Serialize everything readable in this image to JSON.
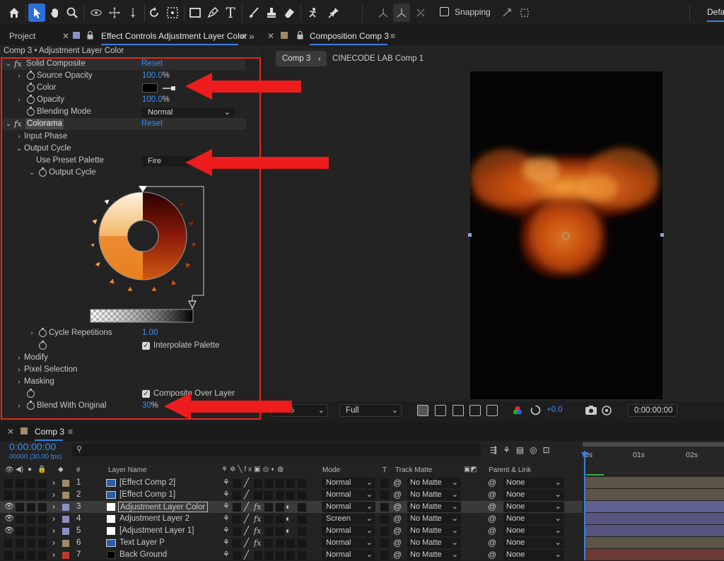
{
  "toolbar": {
    "tools": [
      "home-icon",
      "selection-tool-icon",
      "hand-tool-icon",
      "zoom-tool-icon",
      "orbit-camera-icon",
      "pan-camera-icon",
      "dolly-camera-icon",
      "rotate-tool-icon",
      "pan-behind-icon",
      "rectangle-tool-icon",
      "pen-tool-icon",
      "type-tool-icon",
      "brush-tool-icon",
      "clone-stamp-icon",
      "eraser-icon",
      "roto-brush-icon",
      "puppet-pin-icon"
    ],
    "snapping_label": "Snapping",
    "workspace_label": "Defa"
  },
  "effect_controls": {
    "tab_project": "Project",
    "tab_effect_controls": "Effect Controls Adjustment Layer Color",
    "breadcrumb": "Comp 3 • Adjustment Layer Color",
    "solid_composite": {
      "name": "Solid Composite",
      "reset": "Reset",
      "source_opacity_label": "Source Opacity",
      "source_opacity_value": "100.0",
      "color_label": "Color",
      "opacity_label": "Opacity",
      "opacity_value": "100.0",
      "blending_mode_label": "Blending Mode",
      "blending_mode_value": "Normal"
    },
    "colorama": {
      "name": "Colorama",
      "reset": "Reset",
      "input_phase": "Input Phase",
      "output_cycle": "Output Cycle",
      "use_preset_palette_label": "Use Preset Palette",
      "use_preset_palette_value": "Fire",
      "output_cycle_sub": "Output Cycle",
      "cycle_repetitions_label": "Cycle Repetitions",
      "cycle_repetitions_value": "1.00",
      "interpolate_palette": "Interpolate Palette",
      "modify": "Modify",
      "pixel_selection": "Pixel Selection",
      "masking": "Masking",
      "composite_over_layer": "Composite Over Layer",
      "blend_with_original_label": "Blend With Original",
      "blend_with_original_value": "30",
      "percent": "%"
    },
    "accent_color": "#e0281e"
  },
  "viewer": {
    "tab_title": "Composition Comp 3",
    "breadcrumb_current": "Comp 3",
    "breadcrumb_other": "CINECODE LAB Comp 1",
    "zoom": "50%",
    "resolution": "Full",
    "exposure": "+0.0",
    "timecode": "0:00:00:00"
  },
  "timeline": {
    "tab_title": "Comp 3",
    "timecode": "0:00:00:00",
    "fps": "00000 (30.00 fps)",
    "search_placeholder": "",
    "headers": {
      "num": "#",
      "layer_name": "Layer Name",
      "mode": "Mode",
      "t": "T",
      "track_matte": "Track Matte",
      "parent": "Parent & Link"
    },
    "ruler": [
      "0s",
      "01s",
      "02s"
    ],
    "layers": [
      {
        "num": "1",
        "name": "[Effect Comp 2]",
        "mode": "Normal",
        "matte": "No Matte",
        "parent": "None",
        "label_color": "#a08a6a",
        "icon": "comp",
        "fx": false,
        "half": false
      },
      {
        "num": "2",
        "name": "[Effect Comp 1]",
        "mode": "Normal",
        "matte": "No Matte",
        "parent": "None",
        "label_color": "#a08a6a",
        "icon": "comp",
        "fx": false,
        "half": false
      },
      {
        "num": "3",
        "name": "Adjustment Layer Color",
        "mode": "Normal",
        "matte": "No Matte",
        "parent": "None",
        "label_color": "#8b8fc4",
        "icon": "solid",
        "fx": true,
        "half": true
      },
      {
        "num": "4",
        "name": "Adjustment Layer 2",
        "mode": "Screen",
        "matte": "No Matte",
        "parent": "None",
        "label_color": "#8b8fc4",
        "icon": "solid",
        "fx": true,
        "half": true
      },
      {
        "num": "5",
        "name": "[Adjustment Layer 1]",
        "mode": "Normal",
        "matte": "No Matte",
        "parent": "None",
        "label_color": "#8b8fc4",
        "icon": "solid",
        "fx": true,
        "half": true
      },
      {
        "num": "6",
        "name": "Text Layer P",
        "mode": "Normal",
        "matte": "No Matte",
        "parent": "None",
        "label_color": "#a08a6a",
        "icon": "comp",
        "fx": true,
        "half": false
      },
      {
        "num": "7",
        "name": "Back Ground",
        "mode": "Normal",
        "matte": "No Matte",
        "parent": "None",
        "label_color": "#c0392b",
        "icon": "black",
        "fx": false,
        "half": false
      }
    ]
  }
}
